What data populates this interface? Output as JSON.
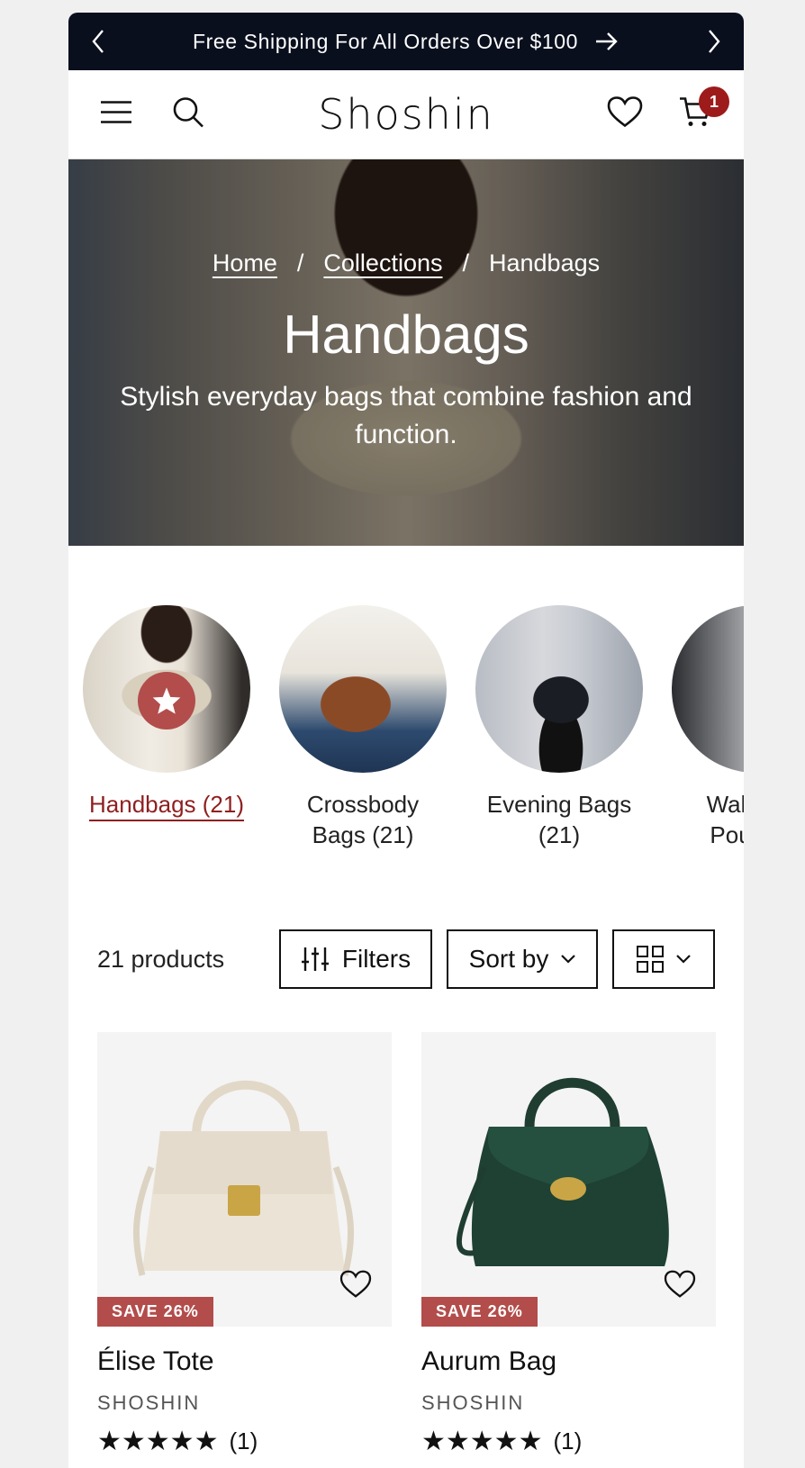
{
  "announcement": {
    "text": "Free Shipping For All Orders Over $100",
    "prev_icon": "chevron-left-icon",
    "next_icon": "chevron-right-icon"
  },
  "header": {
    "logo": "Shoshin",
    "cart_count": "1",
    "icons": [
      "menu-icon",
      "search-icon",
      "heart-icon",
      "cart-icon"
    ]
  },
  "hero": {
    "breadcrumbs": [
      "Home",
      "/",
      "Collections",
      "/",
      "Handbags"
    ],
    "title": "Handbags",
    "subtitle": "Stylish everyday bags that combine fashion and function."
  },
  "categories": [
    {
      "label": "Handbags (21)",
      "active": true
    },
    {
      "label": "Crossbody Bags (21)",
      "active": false
    },
    {
      "label": "Evening Bags (21)",
      "active": false
    },
    {
      "label": "Wallets & Pouches",
      "active": false
    }
  ],
  "toolbar": {
    "count": "21 products",
    "filters": "Filters",
    "sort": "Sort by"
  },
  "products": [
    {
      "name": "Élise Tote",
      "vendor": "SHOSHIN",
      "badge": "SAVE 26%",
      "stars": "★★★★★",
      "reviews": "(1)",
      "rating": 5
    },
    {
      "name": "Aurum Bag",
      "vendor": "SHOSHIN",
      "badge": "SAVE 26%",
      "stars": "★★★★★",
      "reviews": "(1)",
      "rating": 5
    }
  ],
  "colors": {
    "accent": "#b24d4b",
    "announce_bg": "#0a0f1e",
    "active_link": "#8f1f1f",
    "badge": "#9e1b1b"
  }
}
